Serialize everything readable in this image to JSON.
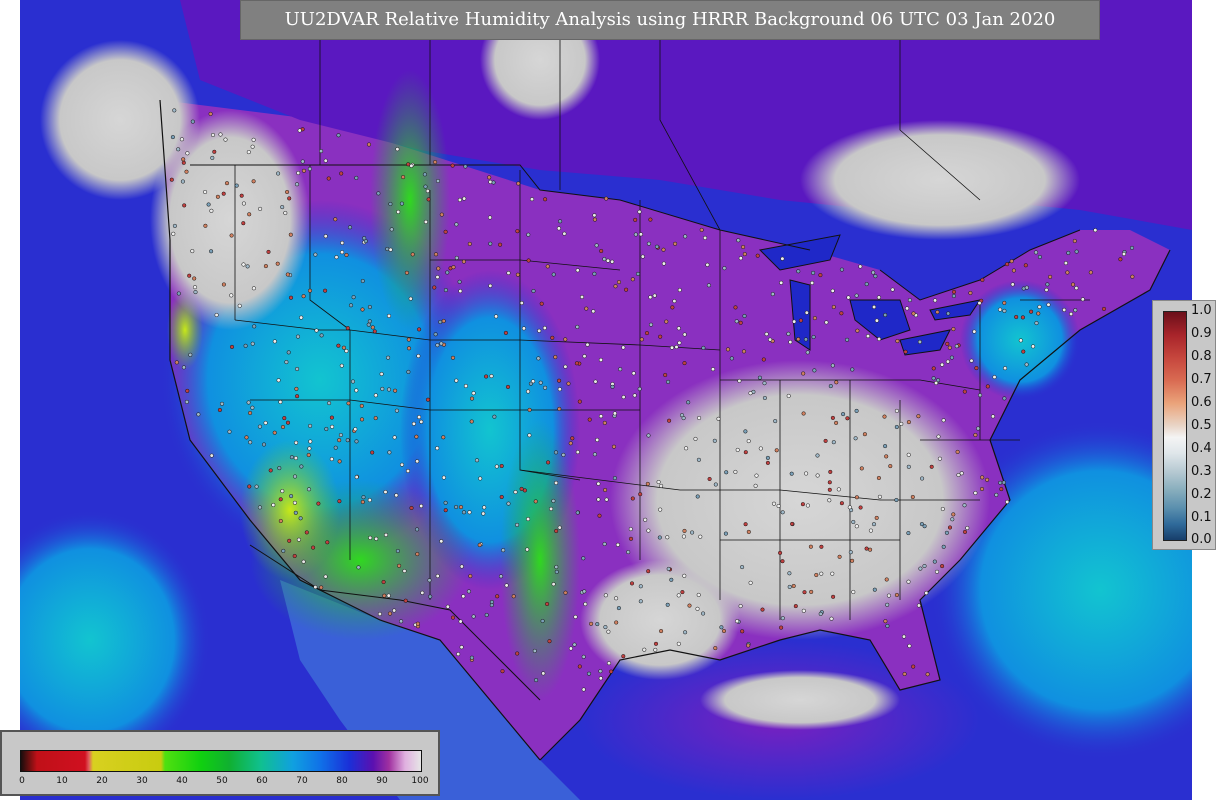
{
  "title": "UU2DVAR Relative Humidity Analysis using HRRR Background 06 UTC 03 Jan 2020",
  "map": {
    "colors": {
      "ocean": "#2a2fd0",
      "land_dry": "#cfcfcf",
      "violet": "#6a1cb8",
      "magenta": "#a030a8",
      "cyan": "#10a8d8",
      "green": "#20c040",
      "yellow_green": "#b0e020",
      "border": "#111111"
    }
  },
  "ratio_legend": {
    "ticks": [
      "1.0",
      "0.9",
      "0.8",
      "0.7",
      "0.6",
      "0.5",
      "0.4",
      "0.3",
      "0.2",
      "0.1",
      "0.0"
    ]
  },
  "rh_legend": {
    "ticks": [
      "0",
      "10",
      "20",
      "30",
      "40",
      "50",
      "60",
      "70",
      "80",
      "90",
      "100"
    ]
  }
}
